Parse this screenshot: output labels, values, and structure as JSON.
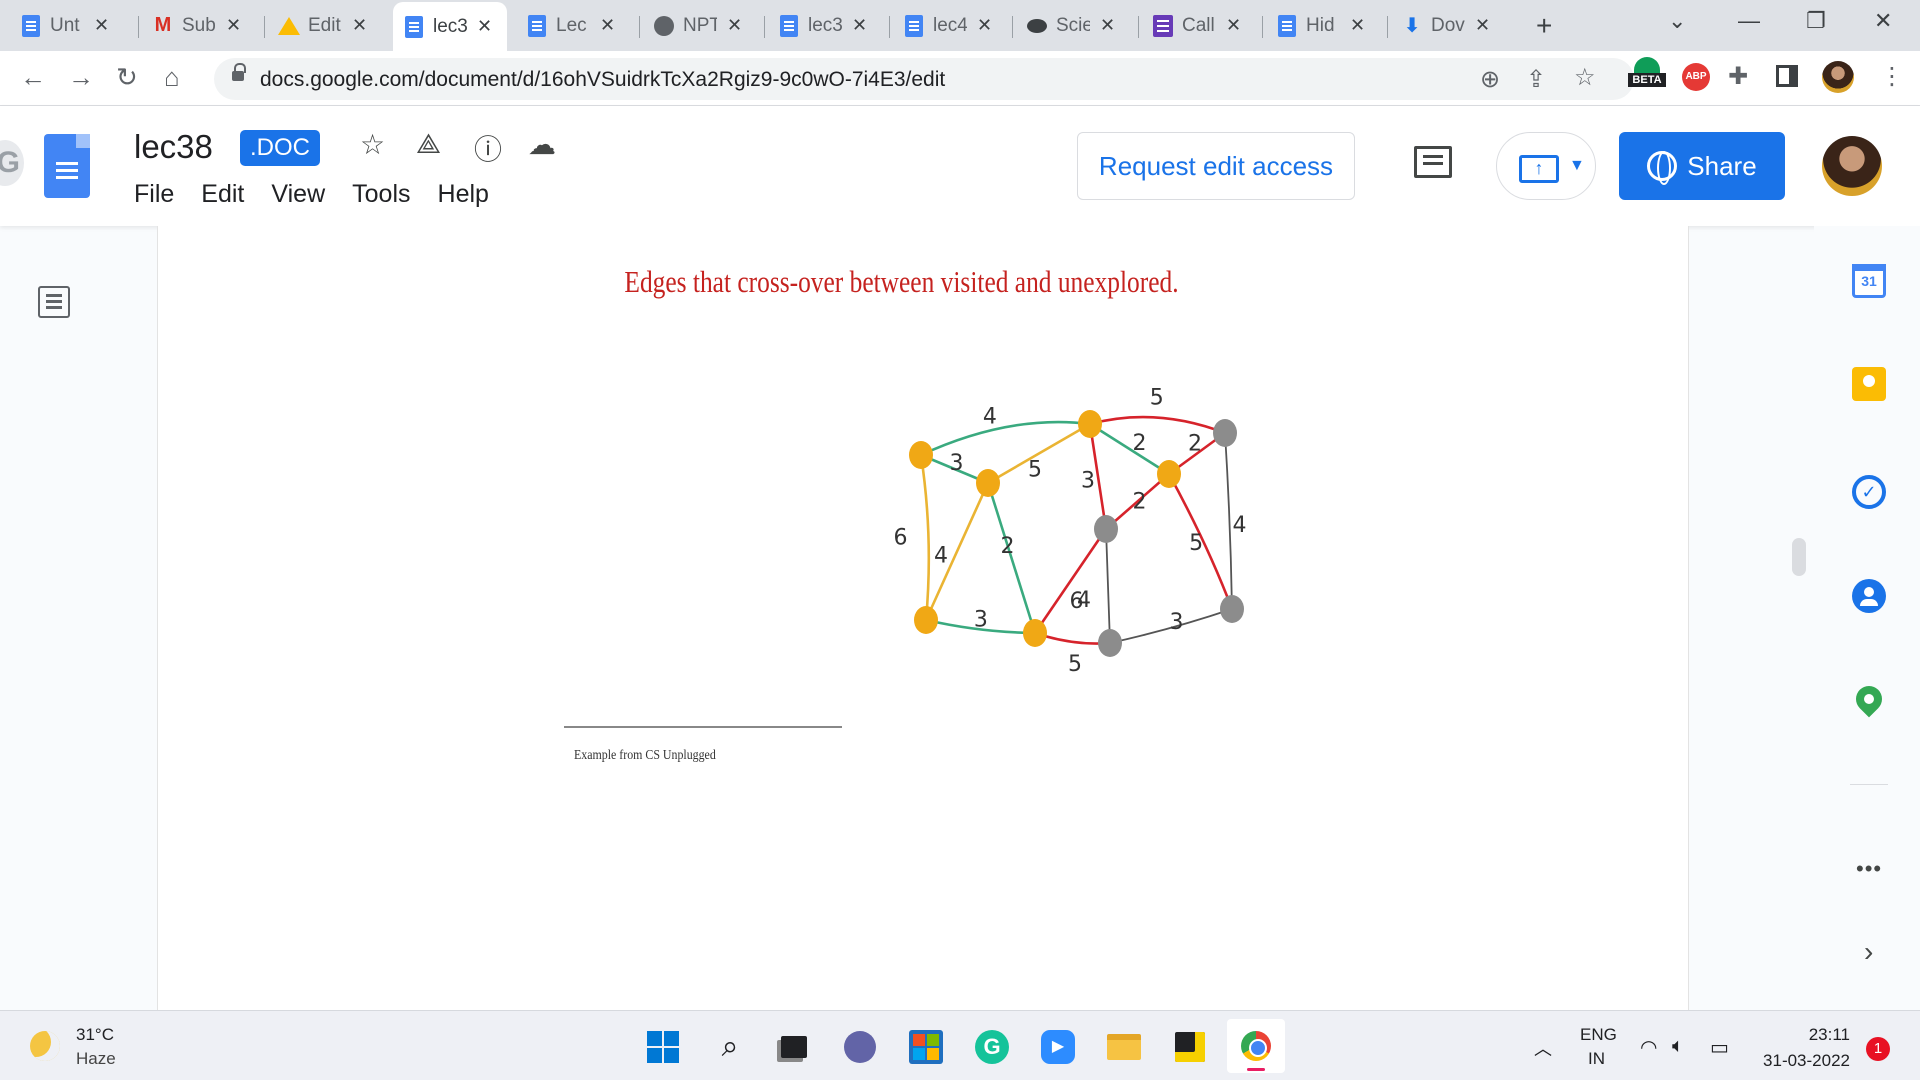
{
  "browser": {
    "tabs": [
      {
        "label": "Unt",
        "icon": "docs-icon"
      },
      {
        "label": "Sub",
        "icon": "gmail-icon"
      },
      {
        "label": "Edit",
        "icon": "drive-icon"
      },
      {
        "label": "lec3",
        "icon": "docs-icon",
        "active": true
      },
      {
        "label": "Lec",
        "icon": "docs-icon"
      },
      {
        "label": "NPT",
        "icon": "globe-icon"
      },
      {
        "label": "lec3",
        "icon": "docs-icon"
      },
      {
        "label": "lec4",
        "icon": "docs-icon"
      },
      {
        "label": "Scie",
        "icon": "bubble-icon"
      },
      {
        "label": "Call",
        "icon": "forms-icon"
      },
      {
        "label": "Hid",
        "icon": "docs-icon"
      },
      {
        "label": "Dov",
        "icon": "download-icon"
      }
    ],
    "url": "docs.google.com/document/d/16ohVSuidrkTcXa2Rgiz9-9c0wO-7i4E3/edit",
    "beta_badge": "BETA",
    "abp_badge": "ABP"
  },
  "docs": {
    "title": "lec38",
    "badge": ".DOC",
    "menu": [
      "File",
      "Edit",
      "View",
      "Tools",
      "Help"
    ],
    "request_edit_label": "Request edit access",
    "share_label": "Share"
  },
  "content": {
    "slide_title": "Edges that cross-over between visited and unexplored.",
    "footnote": "Example from CS Unplugged",
    "graph": {
      "nodes": [
        {
          "id": "A",
          "state": "visited"
        },
        {
          "id": "B",
          "state": "visited"
        },
        {
          "id": "C",
          "state": "visited"
        },
        {
          "id": "D",
          "state": "unexplored"
        },
        {
          "id": "E",
          "state": "visited"
        },
        {
          "id": "F",
          "state": "unexplored"
        },
        {
          "id": "G",
          "state": "visited"
        },
        {
          "id": "H",
          "state": "visited"
        },
        {
          "id": "I",
          "state": "unexplored"
        },
        {
          "id": "J",
          "state": "unexplored"
        }
      ],
      "edges": [
        {
          "from": "A",
          "to": "C",
          "weight": "4",
          "kind": "green"
        },
        {
          "from": "C",
          "to": "D",
          "weight": "5",
          "kind": "red"
        },
        {
          "from": "A",
          "to": "B",
          "weight": "3",
          "kind": "green"
        },
        {
          "from": "B",
          "to": "C",
          "weight": "5",
          "kind": "yellow"
        },
        {
          "from": "C",
          "to": "E",
          "weight": "2",
          "kind": "green"
        },
        {
          "from": "E",
          "to": "D",
          "weight": "2",
          "kind": "red"
        },
        {
          "from": "C",
          "to": "F",
          "weight": "3",
          "kind": "red"
        },
        {
          "from": "A",
          "to": "G",
          "weight": "6",
          "kind": "yellow"
        },
        {
          "from": "B",
          "to": "G",
          "weight": "4",
          "kind": "yellow"
        },
        {
          "from": "B",
          "to": "H",
          "weight": "2",
          "kind": "green"
        },
        {
          "from": "E",
          "to": "F",
          "weight": "2",
          "kind": "red"
        },
        {
          "from": "E",
          "to": "J",
          "weight": "5",
          "kind": "red"
        },
        {
          "from": "D",
          "to": "J",
          "weight": "4",
          "kind": "gray"
        },
        {
          "from": "G",
          "to": "H",
          "weight": "3",
          "kind": "green"
        },
        {
          "from": "H",
          "to": "F",
          "weight": "6",
          "kind": "red"
        },
        {
          "from": "F",
          "to": "I",
          "weight": "4",
          "kind": "gray"
        },
        {
          "from": "H",
          "to": "I",
          "weight": "5",
          "kind": "red"
        },
        {
          "from": "I",
          "to": "J",
          "weight": "3",
          "kind": "gray"
        }
      ]
    }
  },
  "taskbar": {
    "temperature": "31°C",
    "condition": "Haze",
    "lang_top": "ENG",
    "lang_bottom": "IN",
    "time": "23:11",
    "date": "31-03-2022",
    "notifications": "1"
  },
  "colors": {
    "visited_node": "#f0a815",
    "unexplored_node": "#8c8c8c",
    "green_edge": "#3aaa7f",
    "red_edge": "#d6232b",
    "yellow_edge": "#eab433",
    "gray_edge": "#555555",
    "title_red": "#c5221f",
    "accent_blue": "#1a73e8"
  }
}
